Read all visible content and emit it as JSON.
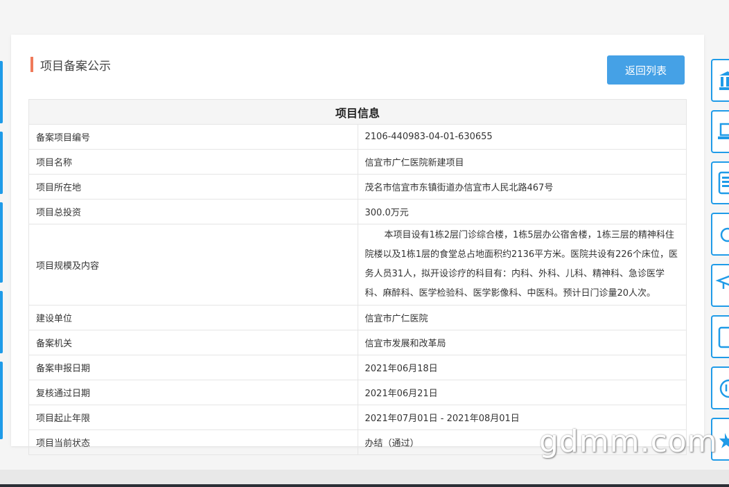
{
  "page": {
    "title": "项目备案公示",
    "back_button": "返回列表"
  },
  "table": {
    "header": "项目信息",
    "rows": [
      {
        "label": "备案项目编号",
        "value": "2106-440983-04-01-630655"
      },
      {
        "label": "项目名称",
        "value": "信宜市广仁医院新建项目"
      },
      {
        "label": "项目所在地",
        "value": "茂名市信宜市东镇街道办信宜市人民北路467号"
      },
      {
        "label": "项目总投资",
        "value": "300.0万元"
      },
      {
        "label": "项目规模及内容",
        "value": "本项目设有1栋2层门诊综合楼，1栋5层办公宿舍楼，1栋三层的精神科住院楼以及1栋1层的食堂总占地面积约2136平方米。医院共设有226个床位，医务人员31人，拟开设诊疗的科目有：内科、外科、儿科、精神科、急诊医学科、麻醉科、医学检验科、医学影像科、中医科。预计日门诊量20人次。"
      },
      {
        "label": "建设单位",
        "value": "信宜市广仁医院"
      },
      {
        "label": "备案机关",
        "value": "信宜市发展和改革局"
      },
      {
        "label": "备案申报日期",
        "value": "2021年06月18日"
      },
      {
        "label": "复核通过日期",
        "value": "2021年06月21日"
      },
      {
        "label": "项目起止年限",
        "value": "2021年07月01日 - 2021年08月01日"
      },
      {
        "label": "项目当前状态",
        "value": "办结（通过）"
      }
    ]
  },
  "sidebar_icons": [
    "bank-icon",
    "laptop-icon",
    "building-icon",
    "search-icon",
    "graduation-icon",
    "document-icon",
    "info-icon",
    "star-icon"
  ],
  "watermark": "gdmm.com",
  "colors": {
    "accent": "#1f9be8",
    "button": "#45a1e6",
    "title_bar": "#f07a5a"
  }
}
